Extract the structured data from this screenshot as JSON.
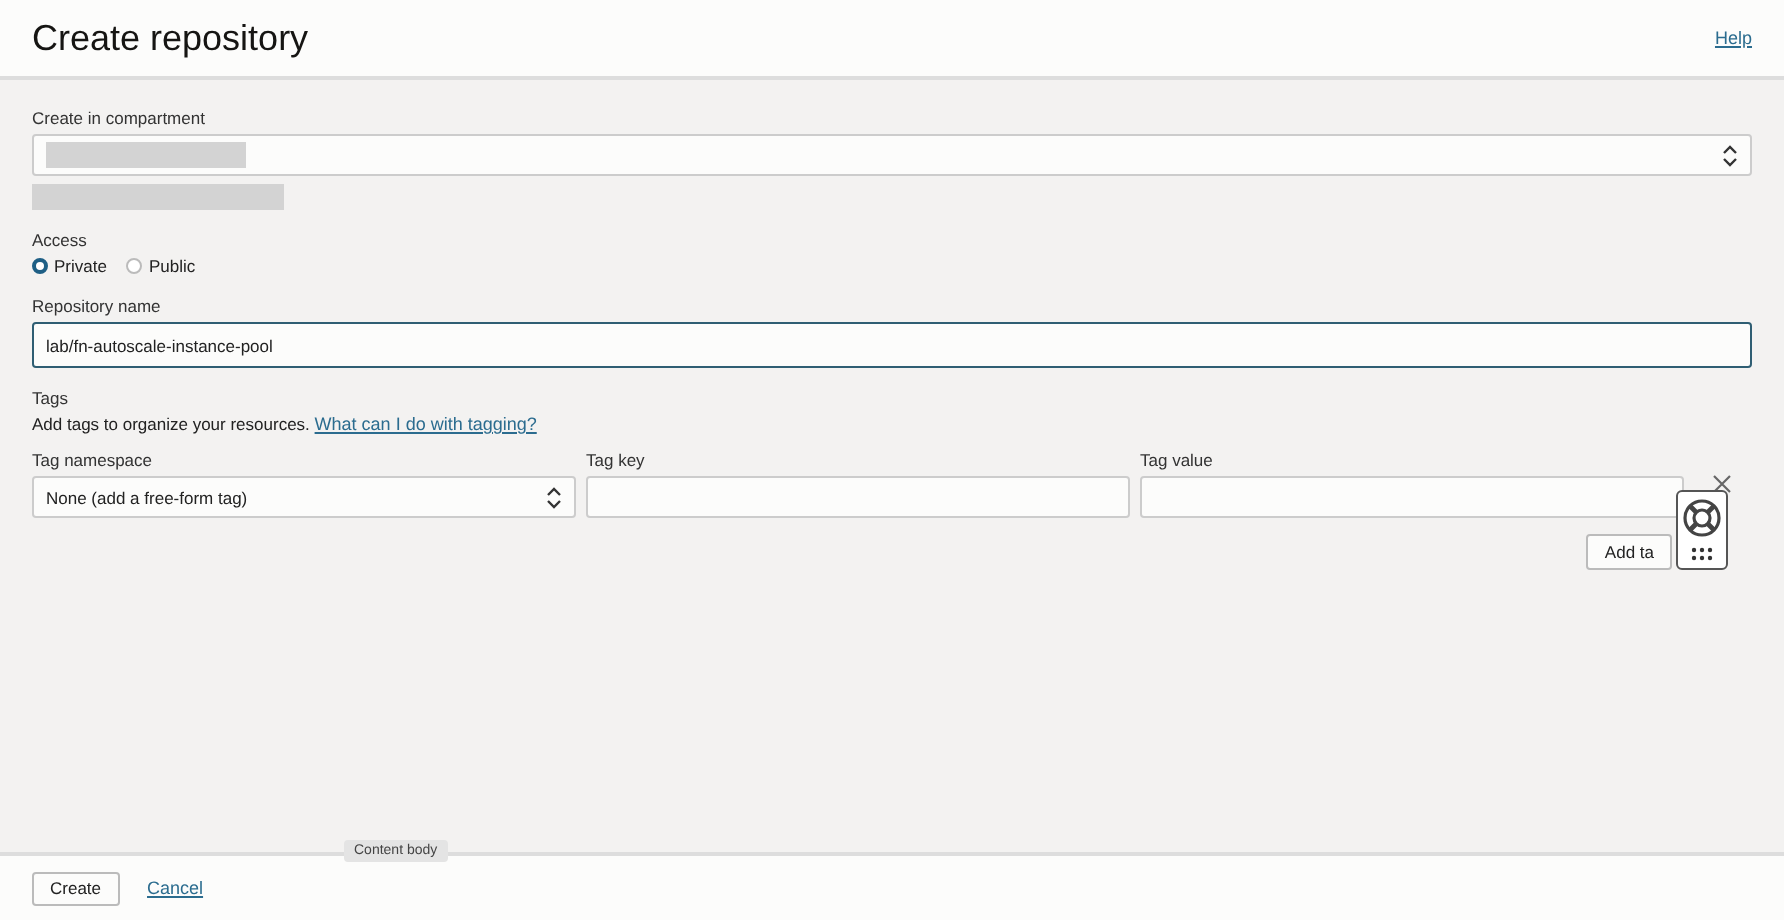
{
  "header": {
    "title": "Create repository",
    "help_link": "Help"
  },
  "compartment": {
    "label": "Create in compartment",
    "redacted": true
  },
  "access": {
    "label": "Access",
    "options": [
      {
        "label": "Private",
        "selected": true
      },
      {
        "label": "Public",
        "selected": false
      }
    ]
  },
  "repository_name": {
    "label": "Repository name",
    "value": "lab/fn-autoscale-instance-pool",
    "focused": true
  },
  "tags": {
    "heading": "Tags",
    "description": "Add tags to organize your resources.",
    "help_link": "What can I do with tagging?",
    "columns": [
      {
        "label": "Tag namespace",
        "kind": "select",
        "value": "None (add a free-form tag)"
      },
      {
        "label": "Tag key",
        "kind": "input"
      },
      {
        "label": "Tag value",
        "kind": "input"
      }
    ],
    "add_button": "Add ta"
  },
  "tooltip": "Content body",
  "footer": {
    "create_button": "Create",
    "cancel_link": "Cancel"
  }
}
